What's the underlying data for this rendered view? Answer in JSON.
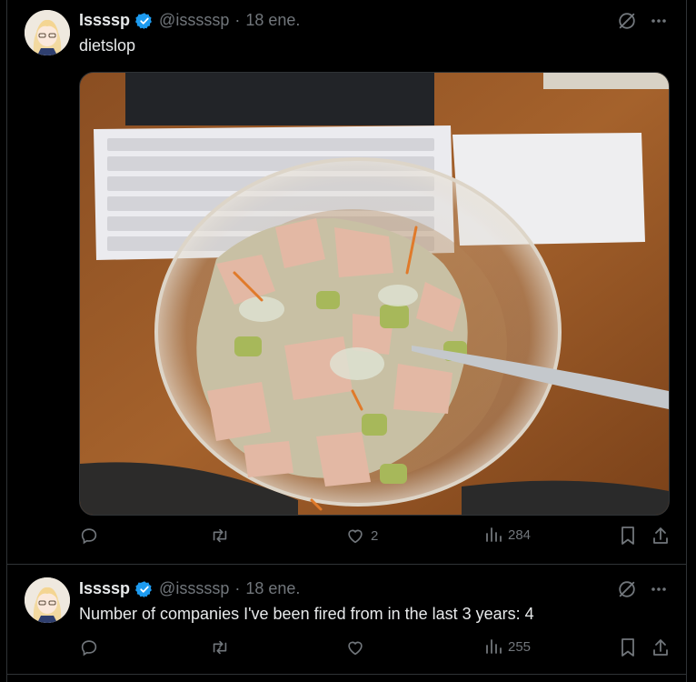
{
  "posts": [
    {
      "author_name": "Issssp",
      "handle": "@isssssp",
      "separator": "·",
      "date": "18 ene.",
      "text": "dietslop",
      "stats": {
        "replies": "",
        "reposts": "",
        "likes": "2",
        "views": "284"
      }
    },
    {
      "author_name": "Issssp",
      "handle": "@isssssp",
      "separator": "·",
      "date": "18 ene.",
      "text": "Number of companies I've been fired from in the last 3 years: 4",
      "stats": {
        "replies": "",
        "reposts": "",
        "likes": "",
        "views": "255"
      }
    }
  ],
  "icons": {
    "verified": "verified-badge-icon",
    "grok": "grok-icon",
    "more": "more-icon",
    "reply": "reply-icon",
    "repost": "repost-icon",
    "like": "like-icon",
    "views": "views-icon",
    "bookmark": "bookmark-icon",
    "share": "share-icon"
  },
  "colors": {
    "background": "#000000",
    "text": "#e7e9ea",
    "muted": "#71767b",
    "verified": "#1d9bf0",
    "divider": "#2f3336"
  }
}
